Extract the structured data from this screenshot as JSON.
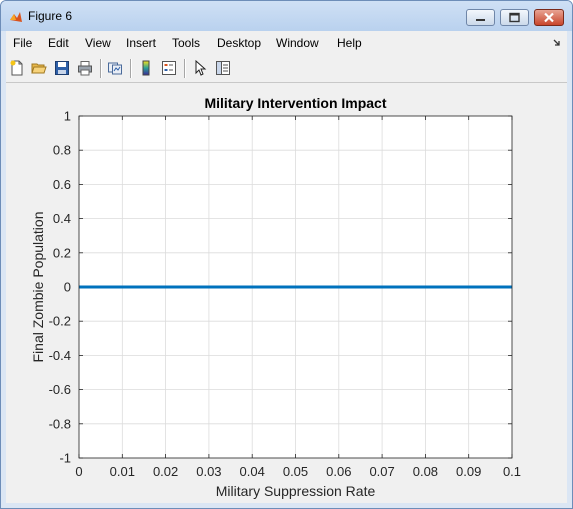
{
  "window": {
    "title": "Figure 6",
    "icon": "matlab-icon",
    "controls": [
      "minimize-icon",
      "restore-icon",
      "close-icon"
    ]
  },
  "menubar": {
    "items": [
      {
        "label": "File"
      },
      {
        "label": "Edit"
      },
      {
        "label": "View"
      },
      {
        "label": "Insert"
      },
      {
        "label": "Tools"
      },
      {
        "label": "Desktop"
      },
      {
        "label": "Window"
      },
      {
        "label": "Help"
      }
    ],
    "overflow_icon": "dock-arrow-icon"
  },
  "toolbar": {
    "icons": [
      "new-figure-icon",
      "open-icon",
      "save-icon",
      "print-icon",
      "link-plot-icon",
      "colorbar-icon",
      "legend-icon",
      "pointer-icon",
      "property-editor-icon"
    ]
  },
  "colors": {
    "line": "#0072bd",
    "grid": "#dcdcdc",
    "axes_bg": "#ffffff",
    "figure_bg": "#f0f0f0",
    "close_button": "#c9462c"
  },
  "chart_data": {
    "type": "line",
    "title": "Military Intervention Impact",
    "xlabel": "Military Suppression Rate",
    "ylabel": "Final Zombie Population",
    "xlim": [
      0,
      0.1
    ],
    "ylim": [
      -1,
      1
    ],
    "grid": true,
    "xticks": [
      0,
      0.01,
      0.02,
      0.03,
      0.04,
      0.05,
      0.06,
      0.07,
      0.08,
      0.09,
      0.1
    ],
    "xtick_labels": [
      "0",
      "0.01",
      "0.02",
      "0.03",
      "0.04",
      "0.05",
      "0.06",
      "0.07",
      "0.08",
      "0.09",
      "0.1"
    ],
    "yticks": [
      1,
      0.8,
      0.6,
      0.4,
      0.2,
      0,
      -0.2,
      -0.4,
      -0.6,
      -0.8,
      -1
    ],
    "ytick_labels": [
      "1",
      "0.8",
      "0.6",
      "0.4",
      "0.2",
      "0",
      "-0.2",
      "-0.4",
      "-0.6",
      "-0.8",
      "-1"
    ],
    "series": [
      {
        "x": [
          0,
          0.1
        ],
        "y": [
          0,
          0
        ]
      }
    ]
  }
}
